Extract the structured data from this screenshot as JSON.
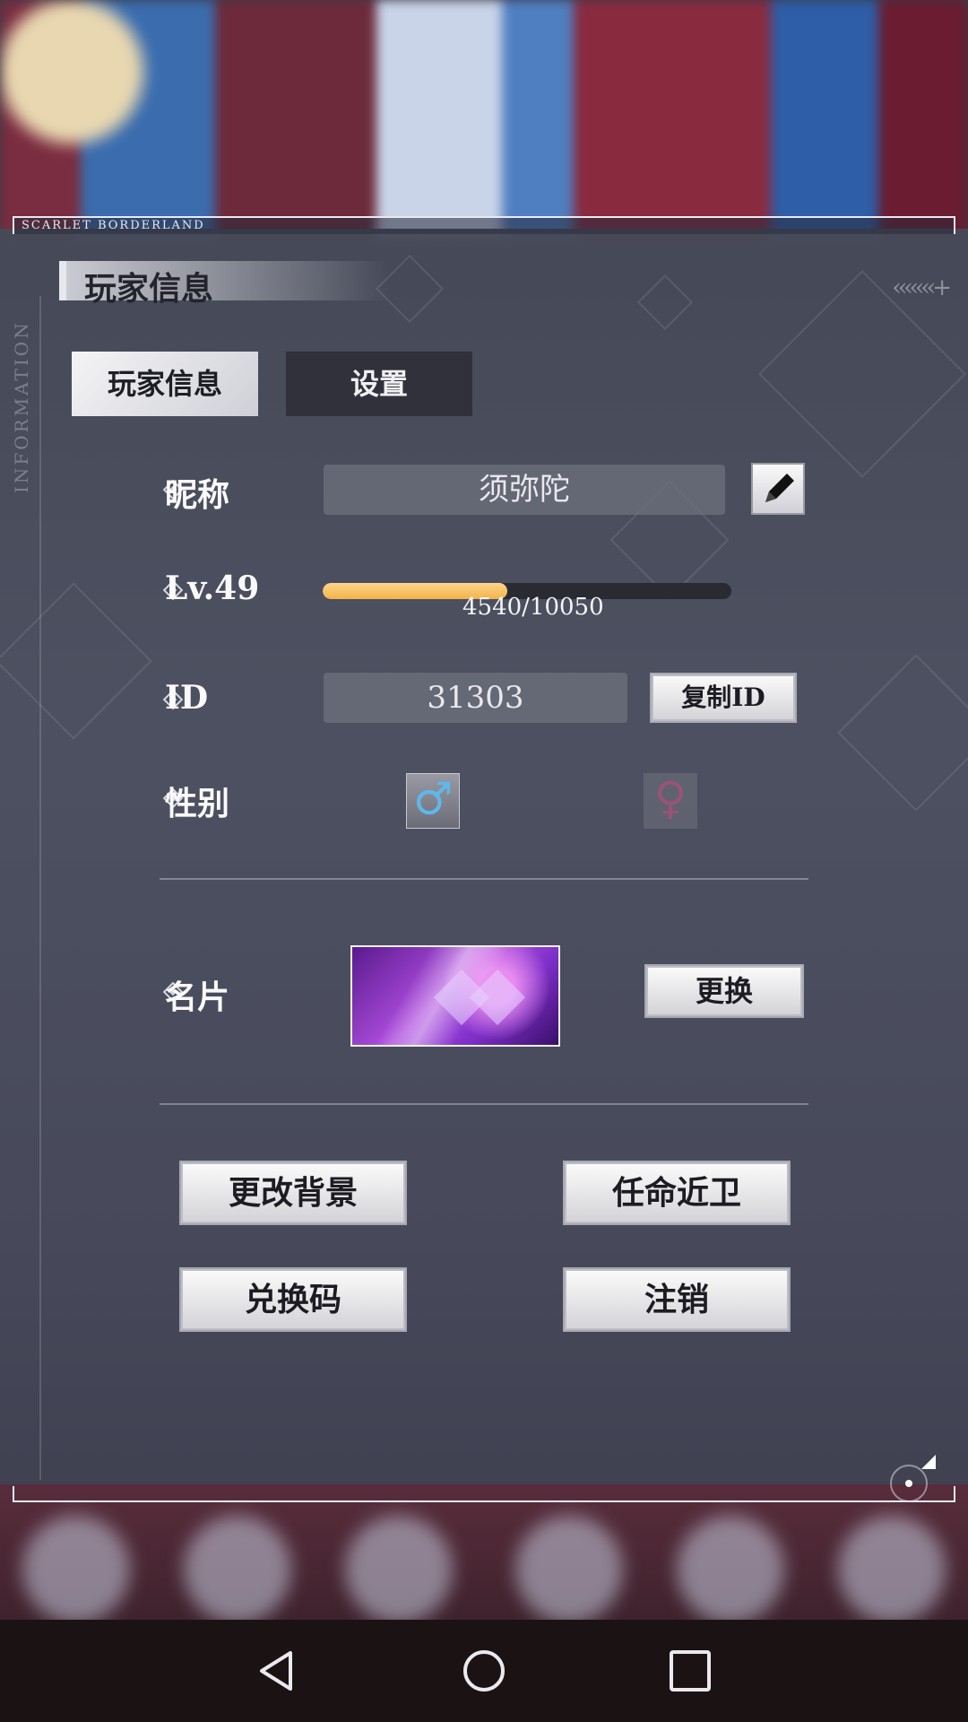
{
  "frame": {
    "brand": "SCARLET BORDERLAND",
    "side_label": "INFORMATION"
  },
  "header": {
    "title": "玩家信息"
  },
  "tabs": [
    {
      "label": "玩家信息",
      "active": true
    },
    {
      "label": "设置",
      "active": false
    }
  ],
  "profile": {
    "nickname_label": "昵称",
    "nickname_value": "须弥陀",
    "level_label": "Lv.49",
    "xp_text": "4540/10050",
    "xp_progress": 0.452,
    "id_label": "ID",
    "id_value": "31303",
    "copy_id_label": "复制ID",
    "gender_label": "性别",
    "gender_male_icon": "♂",
    "gender_female_icon": "♀",
    "gender_selected": "male",
    "namecard_label": "名片",
    "change_namecard_label": "更换"
  },
  "actions": {
    "change_background": "更改背景",
    "appoint_guard": "任命近卫",
    "redeem_code": "兑换码",
    "logout": "注销"
  },
  "colors": {
    "xp_fill": "#f1b34a",
    "male_icon": "#5fb7ea",
    "female_icon": "#c35a8a",
    "namecard_purple": "#b04fe0"
  }
}
